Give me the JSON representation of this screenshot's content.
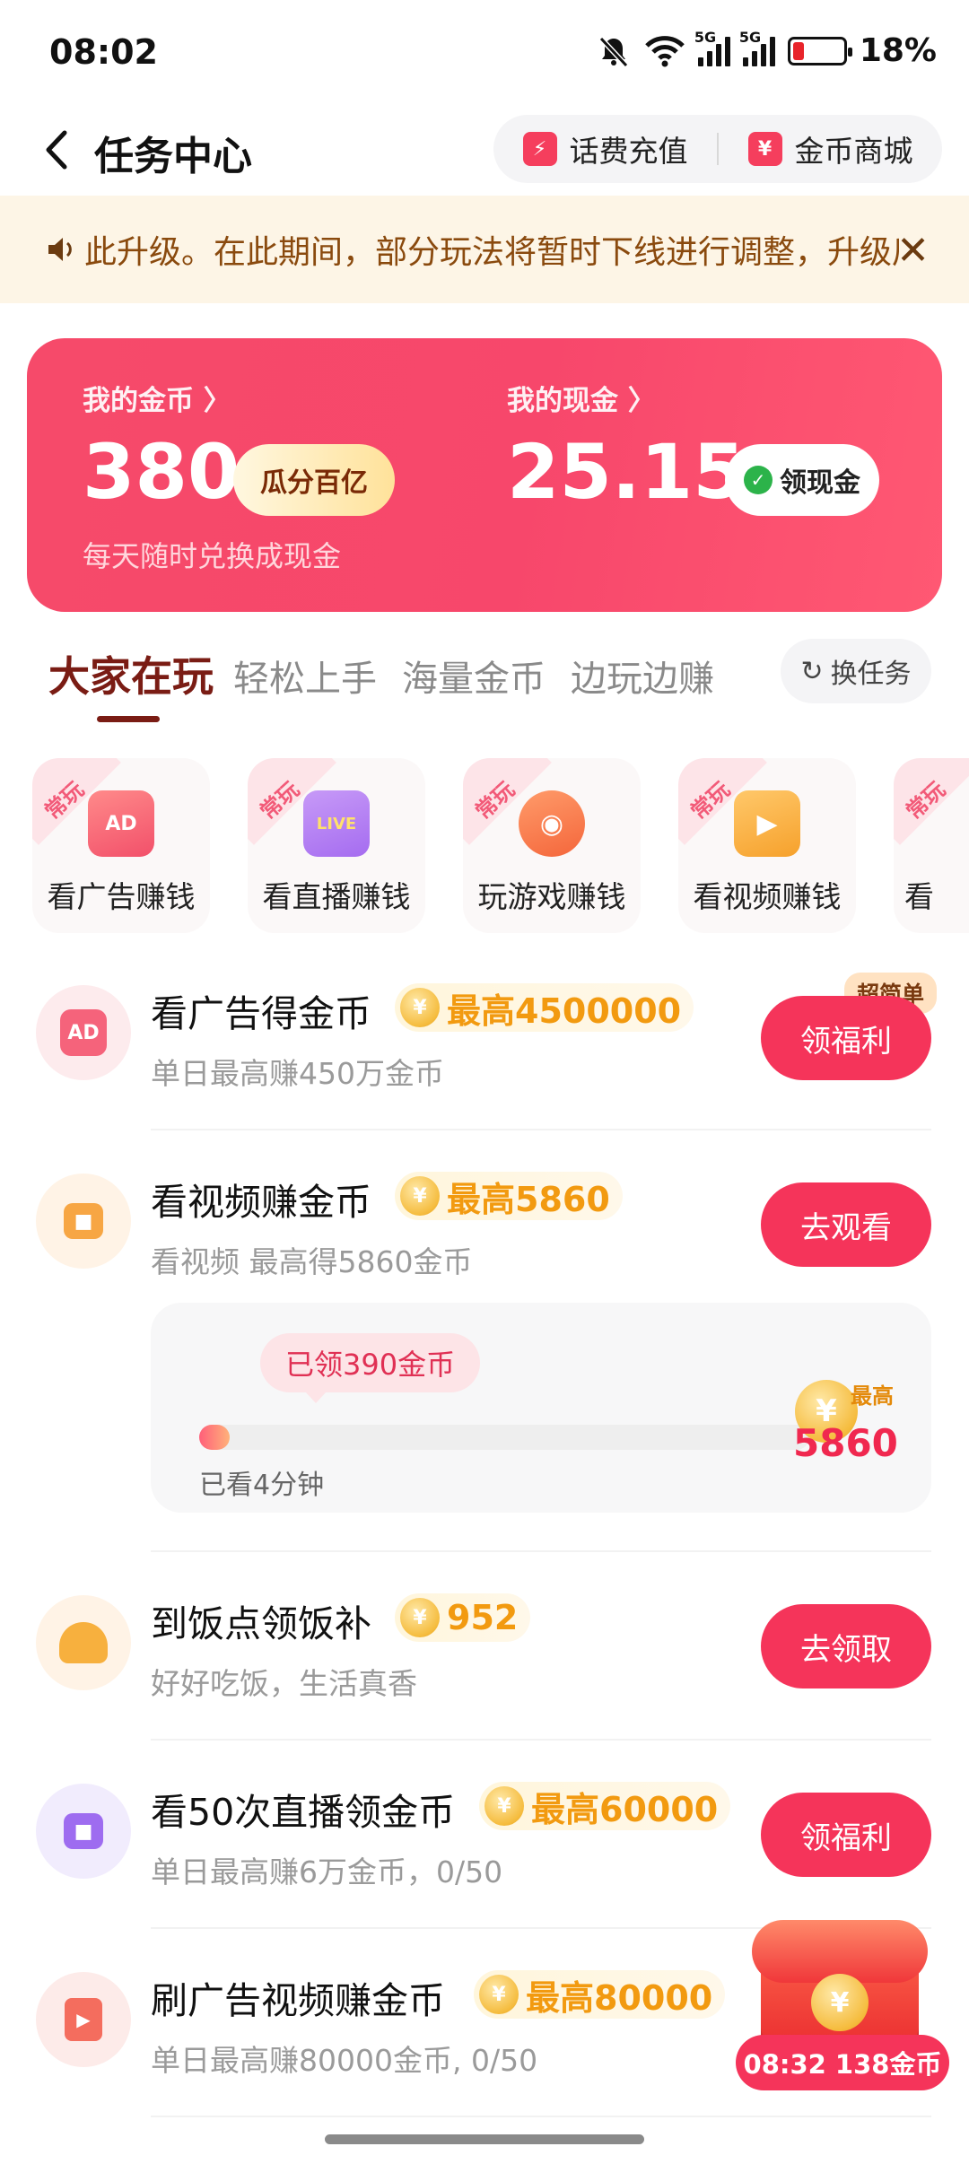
{
  "status_bar": {
    "time": "08:02",
    "battery": "18%",
    "net1": "5G",
    "net2": "5G"
  },
  "header": {
    "title": "任务中心",
    "recharge_label": "话费充值",
    "mall_label": "金币商城",
    "recharge_icon": "⚡",
    "mall_icon": "¥"
  },
  "notice": {
    "text": "此升级。在此期间，部分玩法将暂时下线进行调整，升级后",
    "close": "✕"
  },
  "wallet": {
    "coins_label": "我的金币 〉",
    "coins_value": "380",
    "coins_button": "瓜分百亿",
    "cash_label": "我的现金 〉",
    "cash_value": "25.15",
    "cash_button": "领现金",
    "subtitle": "每天随时兑换成现金"
  },
  "tabs": [
    {
      "label": "大家在玩",
      "active": true
    },
    {
      "label": "轻松上手",
      "active": false
    },
    {
      "label": "海量金币",
      "active": false
    },
    {
      "label": "边玩边赚",
      "active": false
    }
  ],
  "swap_label": "换任务",
  "quick_cards": [
    {
      "tag": "常玩",
      "label": "看广告赚钱",
      "icon": "ad-tv-icon",
      "icon_text": "AD",
      "color": "#f2506a"
    },
    {
      "tag": "常玩",
      "label": "看直播赚钱",
      "icon": "live-tv-icon",
      "icon_text": "LIVE",
      "color": "#a56cf0"
    },
    {
      "tag": "常玩",
      "label": "玩游戏赚钱",
      "icon": "gamepad-icon",
      "icon_text": "◉",
      "color": "#f4663b"
    },
    {
      "tag": "常玩",
      "label": "看视频赚钱",
      "icon": "camera-icon",
      "icon_text": "▶",
      "color": "#f6a12c"
    },
    {
      "tag": "常玩",
      "label": "看",
      "icon": "tv-icon",
      "icon_text": "",
      "color": "#f2506a"
    }
  ],
  "tasks": [
    {
      "title": "看广告得金币",
      "reward": "最高4500000",
      "sub": "单日最高赚450万金币",
      "button": "领福利",
      "badge": "超简单",
      "icon": "ad-icon",
      "icon_text": "AD",
      "icon_bg": "#fdebed",
      "icon_fg": "#f5637b"
    },
    {
      "title": "看视频赚金币",
      "reward": "最高5860",
      "sub": "看视频 最高得5860金币",
      "button": "去观看",
      "icon": "video-camera-icon",
      "icon_text": "■",
      "icon_bg": "#fff3e6",
      "icon_fg": "#f7a644"
    },
    {
      "title": "到饭点领饭补",
      "reward": "952",
      "sub": "好好吃饭，生活真香",
      "button": "去领取",
      "icon": "meal-icon",
      "icon_text": "",
      "icon_bg": "#fff3e6",
      "icon_fg": "#f7b03e"
    },
    {
      "title": "看50次直播领金币",
      "reward": "最高60000",
      "sub": "单日最高赚6万金币，0/50",
      "button": "领福利",
      "icon": "live-camera-icon",
      "icon_text": "■",
      "icon_bg": "#f1ecfd",
      "icon_fg": "#9e6cf0"
    },
    {
      "title": "刷广告视频赚金币",
      "reward": "最高80000",
      "sub": "单日最高赚80000金币, 0/50",
      "button": "领福利",
      "icon": "play-video-icon",
      "icon_text": "▶",
      "icon_bg": "#fdebe9",
      "icon_fg": "#f46d5e"
    }
  ],
  "video_progress": {
    "claimed": "已领390金币",
    "watched": "已看4分钟",
    "max_label": "最高",
    "max_value": "5860",
    "fraction": 0.05
  },
  "coin_symbol": "¥",
  "chest": {
    "timer": "08:32 138金币"
  }
}
